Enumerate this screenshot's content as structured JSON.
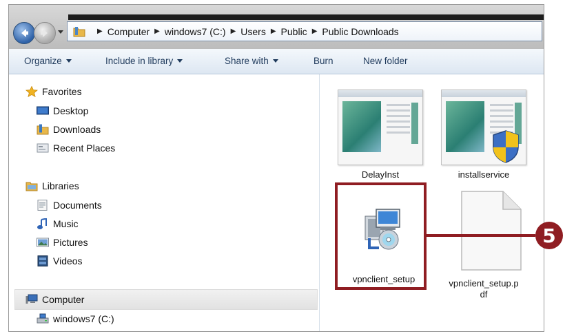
{
  "address": {
    "crumbs": [
      "Computer",
      "windows7 (C:)",
      "Users",
      "Public",
      "Public Downloads"
    ]
  },
  "toolbar": {
    "organize": "Organize",
    "include_in_library": "Include in library",
    "share_with": "Share with",
    "burn": "Burn",
    "new_folder": "New folder"
  },
  "nav": {
    "favorites": "Favorites",
    "desktop": "Desktop",
    "downloads": "Downloads",
    "recent_places": "Recent Places",
    "libraries": "Libraries",
    "documents": "Documents",
    "music": "Music",
    "pictures": "Pictures",
    "videos": "Videos",
    "computer": "Computer",
    "drive_c": "windows7 (C:)"
  },
  "files": {
    "delayinst": "DelayInst",
    "installservice": "installservice",
    "vpnclient_setup": "vpnclient_setup",
    "vpnclient_setup_pdf_line1": "vpnclient_setup.p",
    "vpnclient_setup_pdf_line2": "df"
  },
  "callout": {
    "number": "5",
    "color": "#8f1d22"
  },
  "icons": {
    "back": "back-arrow-icon",
    "forward": "forward-arrow-icon",
    "favorites": "star-icon",
    "desktop": "desktop-icon",
    "downloads": "downloads-folder-icon",
    "recent": "recent-places-icon",
    "libraries": "libraries-icon",
    "documents": "documents-icon",
    "music": "music-note-icon",
    "pictures": "pictures-icon",
    "videos": "videos-icon",
    "computer": "computer-icon",
    "drive": "drive-icon",
    "installer": "installer-package-icon",
    "uac_shield": "uac-shield-icon",
    "blank_file": "blank-document-icon"
  }
}
